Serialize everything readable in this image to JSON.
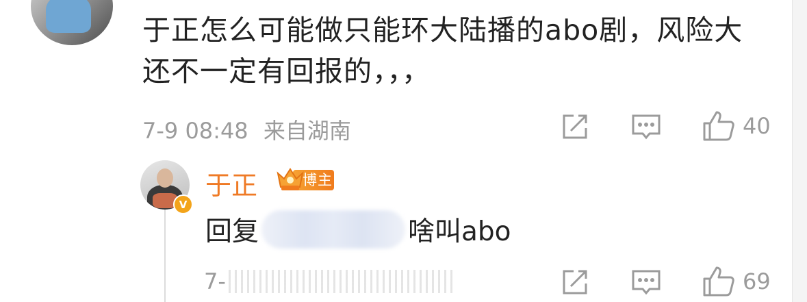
{
  "comment": {
    "text": "于正怎么可能做只能环大陆播的abo剧，风险大还不一定有回报的，，，",
    "time": "7-9 08:48",
    "location": "来自湖南",
    "like_count": "40"
  },
  "reply": {
    "username": "于正",
    "badge": "博主",
    "verified_mark": "V",
    "prefix": "回复",
    "text": "啥叫abo",
    "time_prefix": "7-",
    "like_count": "69"
  },
  "icons": {
    "share": "share-icon",
    "comment": "comment-icon",
    "like": "thumbs-up-icon"
  },
  "colors": {
    "username": "#ef7a25",
    "meta": "#9b9b9b",
    "text": "#222222",
    "badge": "#f28a25"
  }
}
